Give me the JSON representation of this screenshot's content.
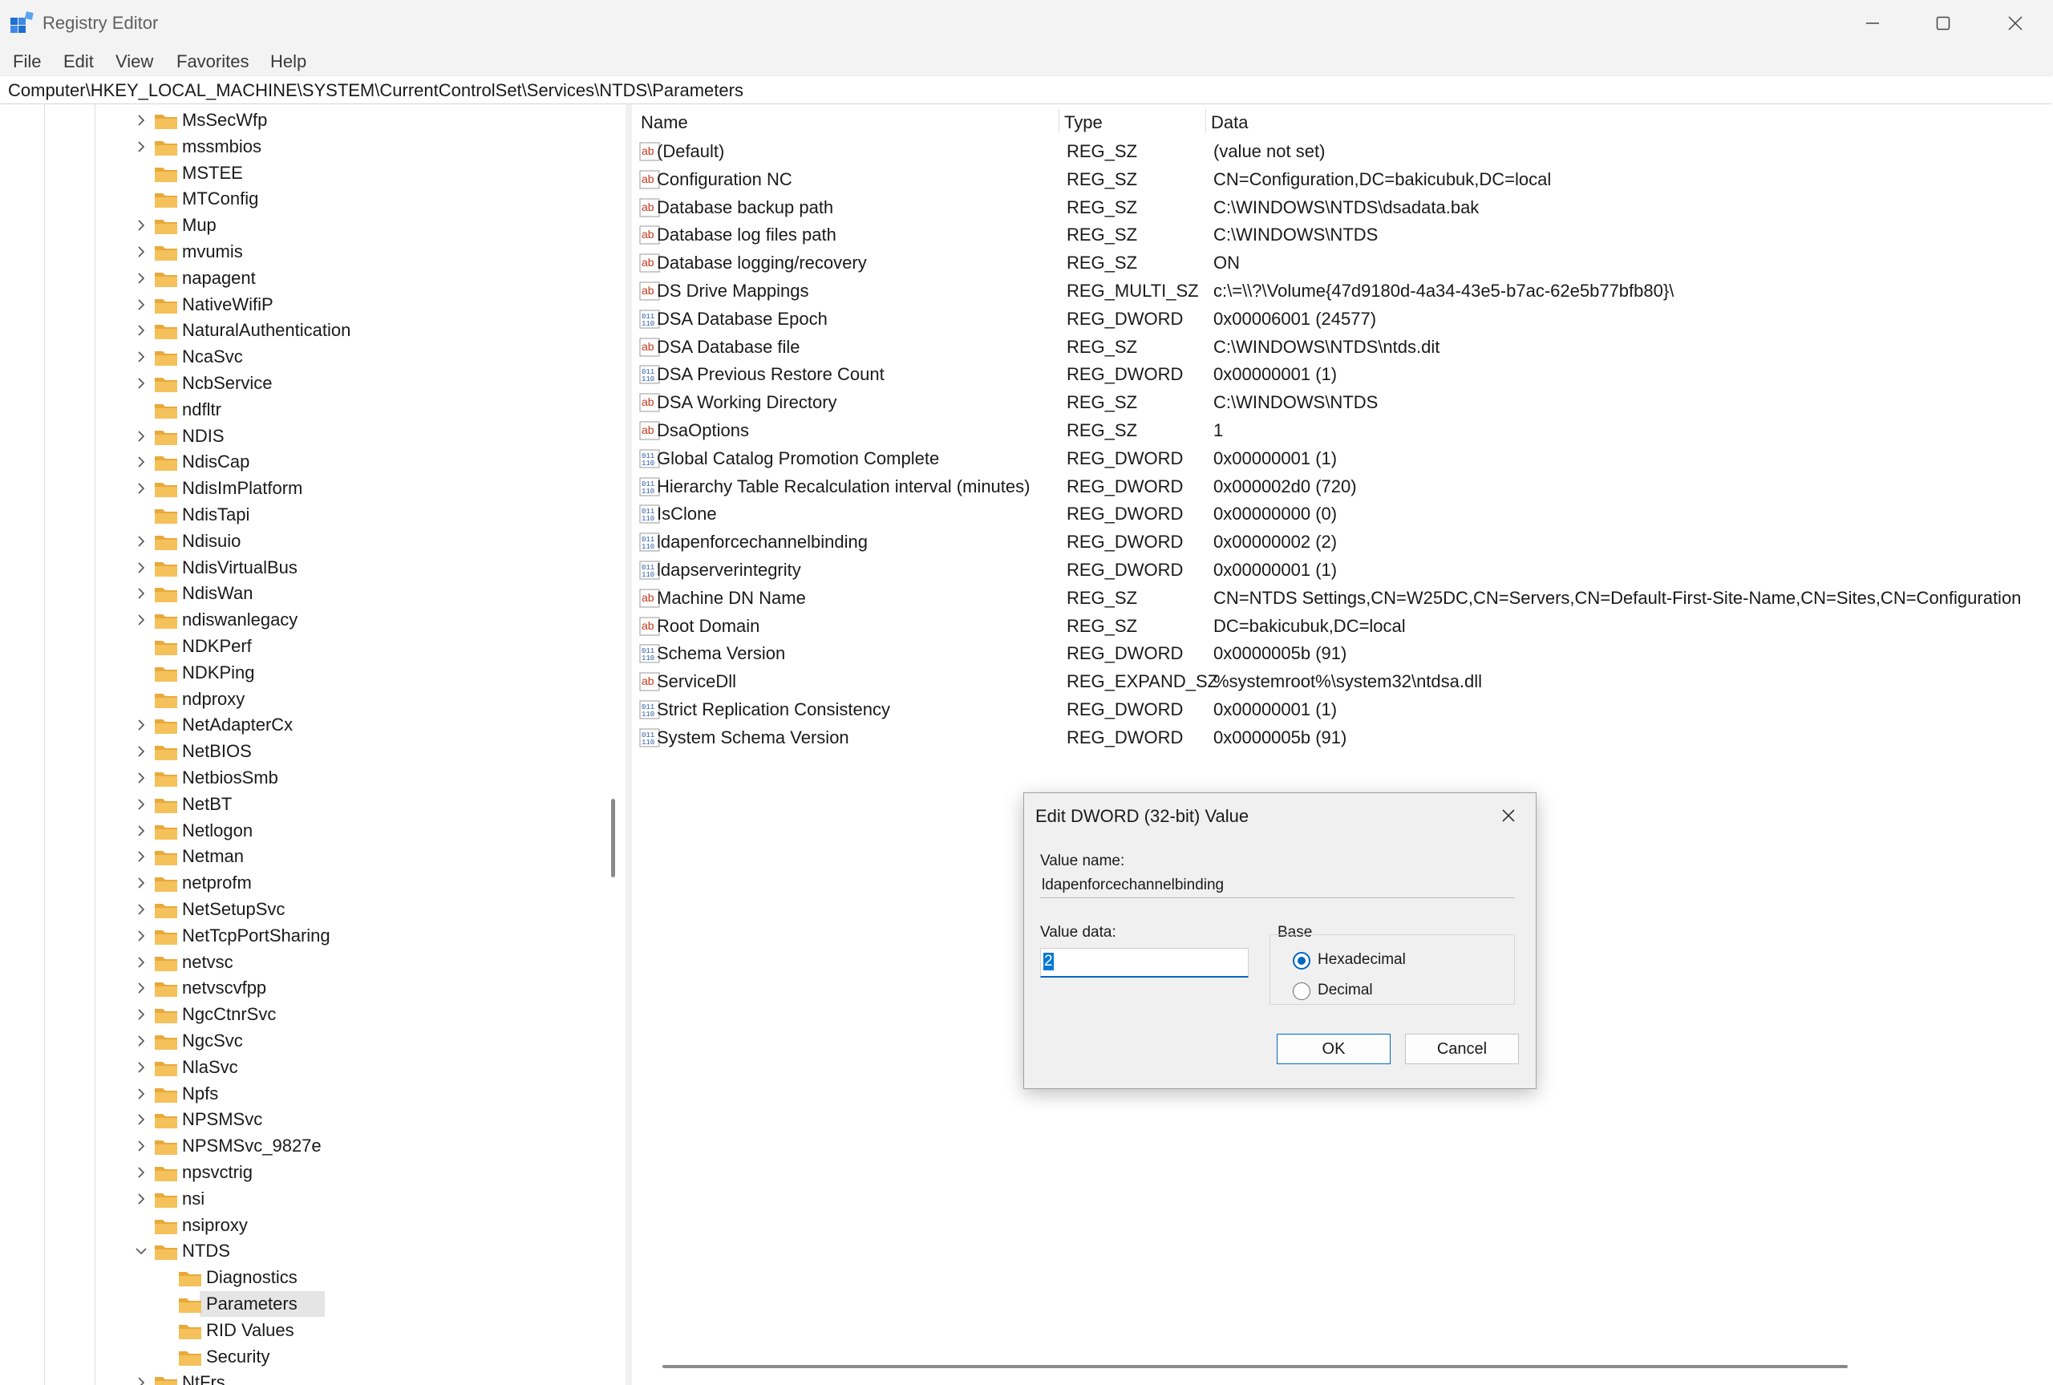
{
  "window": {
    "title": "Registry Editor",
    "colors": {
      "accent": "#0067c0",
      "folder": "#f4c15b",
      "selection": "#e5e5e5"
    }
  },
  "menu": [
    "File",
    "Edit",
    "View",
    "Favorites",
    "Help"
  ],
  "address": "Computer\\HKEY_LOCAL_MACHINE\\SYSTEM\\CurrentControlSet\\Services\\NTDS\\Parameters",
  "tree": [
    {
      "label": "MsSecWfp",
      "expandable": true,
      "indent": 0
    },
    {
      "label": "mssmbios",
      "expandable": true,
      "indent": 0
    },
    {
      "label": "MSTEE",
      "expandable": false,
      "indent": 0
    },
    {
      "label": "MTConfig",
      "expandable": false,
      "indent": 0
    },
    {
      "label": "Mup",
      "expandable": true,
      "indent": 0
    },
    {
      "label": "mvumis",
      "expandable": true,
      "indent": 0
    },
    {
      "label": "napagent",
      "expandable": true,
      "indent": 0
    },
    {
      "label": "NativeWifiP",
      "expandable": true,
      "indent": 0
    },
    {
      "label": "NaturalAuthentication",
      "expandable": true,
      "indent": 0
    },
    {
      "label": "NcaSvc",
      "expandable": true,
      "indent": 0
    },
    {
      "label": "NcbService",
      "expandable": true,
      "indent": 0
    },
    {
      "label": "ndfltr",
      "expandable": false,
      "indent": 0
    },
    {
      "label": "NDIS",
      "expandable": true,
      "indent": 0
    },
    {
      "label": "NdisCap",
      "expandable": true,
      "indent": 0
    },
    {
      "label": "NdisImPlatform",
      "expandable": true,
      "indent": 0
    },
    {
      "label": "NdisTapi",
      "expandable": false,
      "indent": 0
    },
    {
      "label": "Ndisuio",
      "expandable": true,
      "indent": 0
    },
    {
      "label": "NdisVirtualBus",
      "expandable": true,
      "indent": 0
    },
    {
      "label": "NdisWan",
      "expandable": true,
      "indent": 0
    },
    {
      "label": "ndiswanlegacy",
      "expandable": true,
      "indent": 0
    },
    {
      "label": "NDKPerf",
      "expandable": false,
      "indent": 0
    },
    {
      "label": "NDKPing",
      "expandable": false,
      "indent": 0
    },
    {
      "label": "ndproxy",
      "expandable": false,
      "indent": 0
    },
    {
      "label": "NetAdapterCx",
      "expandable": true,
      "indent": 0
    },
    {
      "label": "NetBIOS",
      "expandable": true,
      "indent": 0
    },
    {
      "label": "NetbiosSmb",
      "expandable": true,
      "indent": 0
    },
    {
      "label": "NetBT",
      "expandable": true,
      "indent": 0
    },
    {
      "label": "Netlogon",
      "expandable": true,
      "indent": 0
    },
    {
      "label": "Netman",
      "expandable": true,
      "indent": 0
    },
    {
      "label": "netprofm",
      "expandable": true,
      "indent": 0
    },
    {
      "label": "NetSetupSvc",
      "expandable": true,
      "indent": 0
    },
    {
      "label": "NetTcpPortSharing",
      "expandable": true,
      "indent": 0
    },
    {
      "label": "netvsc",
      "expandable": true,
      "indent": 0
    },
    {
      "label": "netvscvfpp",
      "expandable": true,
      "indent": 0
    },
    {
      "label": "NgcCtnrSvc",
      "expandable": true,
      "indent": 0
    },
    {
      "label": "NgcSvc",
      "expandable": true,
      "indent": 0
    },
    {
      "label": "NlaSvc",
      "expandable": true,
      "indent": 0
    },
    {
      "label": "Npfs",
      "expandable": true,
      "indent": 0
    },
    {
      "label": "NPSMSvc",
      "expandable": true,
      "indent": 0
    },
    {
      "label": "NPSMSvc_9827e",
      "expandable": true,
      "indent": 0
    },
    {
      "label": "npsvctrig",
      "expandable": true,
      "indent": 0
    },
    {
      "label": "nsi",
      "expandable": true,
      "indent": 0
    },
    {
      "label": "nsiproxy",
      "expandable": false,
      "indent": 0
    },
    {
      "label": "NTDS",
      "expandable": true,
      "expanded": true,
      "indent": 0
    },
    {
      "label": "Diagnostics",
      "expandable": false,
      "indent": 1
    },
    {
      "label": "Parameters",
      "expandable": false,
      "indent": 1,
      "selected": true
    },
    {
      "label": "RID Values",
      "expandable": false,
      "indent": 1
    },
    {
      "label": "Security",
      "expandable": false,
      "indent": 1
    },
    {
      "label": "NtFrs",
      "expandable": true,
      "indent": 0
    }
  ],
  "list": {
    "headers": {
      "name": "Name",
      "type": "Type",
      "data": "Data"
    },
    "rows": [
      {
        "icon": "string-value-icon",
        "name": "(Default)",
        "type": "REG_SZ",
        "data": "(value not set)"
      },
      {
        "icon": "string-value-icon",
        "name": "Configuration NC",
        "type": "REG_SZ",
        "data": "CN=Configuration,DC=bakicubuk,DC=local"
      },
      {
        "icon": "string-value-icon",
        "name": "Database backup path",
        "type": "REG_SZ",
        "data": "C:\\WINDOWS\\NTDS\\dsadata.bak"
      },
      {
        "icon": "string-value-icon",
        "name": "Database log files path",
        "type": "REG_SZ",
        "data": "C:\\WINDOWS\\NTDS"
      },
      {
        "icon": "string-value-icon",
        "name": "Database logging/recovery",
        "type": "REG_SZ",
        "data": "ON"
      },
      {
        "icon": "string-value-icon",
        "name": "DS Drive Mappings",
        "type": "REG_MULTI_SZ",
        "data": "c:\\=\\\\?\\Volume{47d9180d-4a34-43e5-b7ac-62e5b77bfb80}\\"
      },
      {
        "icon": "binary-value-icon",
        "name": "DSA Database Epoch",
        "type": "REG_DWORD",
        "data": "0x00006001 (24577)"
      },
      {
        "icon": "string-value-icon",
        "name": "DSA Database file",
        "type": "REG_SZ",
        "data": "C:\\WINDOWS\\NTDS\\ntds.dit"
      },
      {
        "icon": "binary-value-icon",
        "name": "DSA Previous Restore Count",
        "type": "REG_DWORD",
        "data": "0x00000001 (1)"
      },
      {
        "icon": "string-value-icon",
        "name": "DSA Working Directory",
        "type": "REG_SZ",
        "data": "C:\\WINDOWS\\NTDS"
      },
      {
        "icon": "string-value-icon",
        "name": "DsaOptions",
        "type": "REG_SZ",
        "data": "1"
      },
      {
        "icon": "binary-value-icon",
        "name": "Global Catalog Promotion Complete",
        "type": "REG_DWORD",
        "data": "0x00000001 (1)"
      },
      {
        "icon": "binary-value-icon",
        "name": "Hierarchy Table Recalculation interval (minutes)",
        "type": "REG_DWORD",
        "data": "0x000002d0 (720)"
      },
      {
        "icon": "binary-value-icon",
        "name": "IsClone",
        "type": "REG_DWORD",
        "data": "0x00000000 (0)"
      },
      {
        "icon": "binary-value-icon",
        "name": "ldapenforcechannelbinding",
        "type": "REG_DWORD",
        "data": "0x00000002 (2)"
      },
      {
        "icon": "binary-value-icon",
        "name": "ldapserverintegrity",
        "type": "REG_DWORD",
        "data": "0x00000001 (1)"
      },
      {
        "icon": "string-value-icon",
        "name": "Machine DN Name",
        "type": "REG_SZ",
        "data": "CN=NTDS Settings,CN=W25DC,CN=Servers,CN=Default-First-Site-Name,CN=Sites,CN=Configuration"
      },
      {
        "icon": "string-value-icon",
        "name": "Root Domain",
        "type": "REG_SZ",
        "data": "DC=bakicubuk,DC=local"
      },
      {
        "icon": "binary-value-icon",
        "name": "Schema Version",
        "type": "REG_DWORD",
        "data": "0x0000005b (91)"
      },
      {
        "icon": "string-value-icon",
        "name": "ServiceDll",
        "type": "REG_EXPAND_SZ",
        "data": "%systemroot%\\system32\\ntdsa.dll"
      },
      {
        "icon": "binary-value-icon",
        "name": "Strict Replication Consistency",
        "type": "REG_DWORD",
        "data": "0x00000001 (1)"
      },
      {
        "icon": "binary-value-icon",
        "name": "System Schema Version",
        "type": "REG_DWORD",
        "data": "0x0000005b (91)"
      }
    ]
  },
  "dialog": {
    "title": "Edit DWORD (32-bit) Value",
    "value_name_label": "Value name:",
    "value_name": "ldapenforcechannelbinding",
    "value_data_label": "Value data:",
    "value_data": "2",
    "base_label": "Base",
    "base_options": [
      {
        "label": "Hexadecimal",
        "checked": true
      },
      {
        "label": "Decimal",
        "checked": false
      }
    ],
    "ok_label": "OK",
    "cancel_label": "Cancel"
  }
}
